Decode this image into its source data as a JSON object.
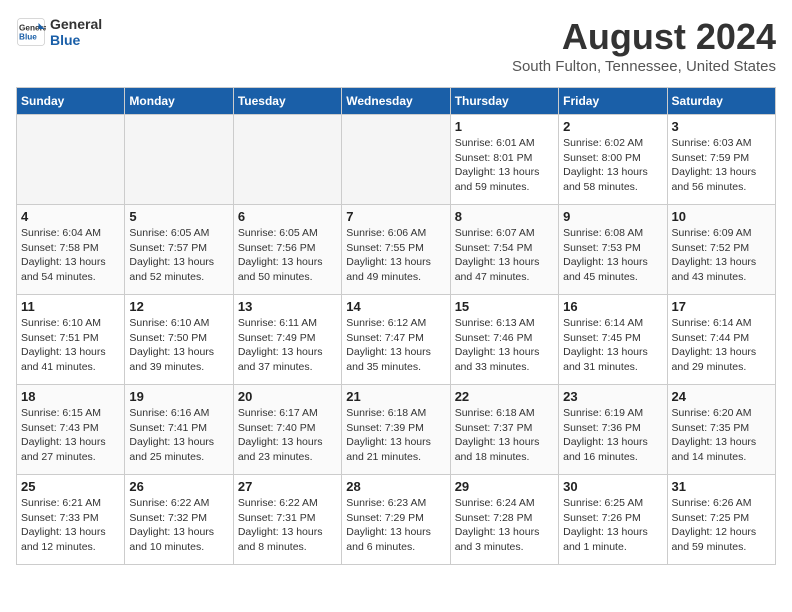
{
  "logo": {
    "line1": "General",
    "line2": "Blue"
  },
  "title": "August 2024",
  "location": "South Fulton, Tennessee, United States",
  "days_of_week": [
    "Sunday",
    "Monday",
    "Tuesday",
    "Wednesday",
    "Thursday",
    "Friday",
    "Saturday"
  ],
  "weeks": [
    [
      {
        "day": "",
        "info": ""
      },
      {
        "day": "",
        "info": ""
      },
      {
        "day": "",
        "info": ""
      },
      {
        "day": "",
        "info": ""
      },
      {
        "day": "1",
        "info": "Sunrise: 6:01 AM\nSunset: 8:01 PM\nDaylight: 13 hours\nand 59 minutes."
      },
      {
        "day": "2",
        "info": "Sunrise: 6:02 AM\nSunset: 8:00 PM\nDaylight: 13 hours\nand 58 minutes."
      },
      {
        "day": "3",
        "info": "Sunrise: 6:03 AM\nSunset: 7:59 PM\nDaylight: 13 hours\nand 56 minutes."
      }
    ],
    [
      {
        "day": "4",
        "info": "Sunrise: 6:04 AM\nSunset: 7:58 PM\nDaylight: 13 hours\nand 54 minutes."
      },
      {
        "day": "5",
        "info": "Sunrise: 6:05 AM\nSunset: 7:57 PM\nDaylight: 13 hours\nand 52 minutes."
      },
      {
        "day": "6",
        "info": "Sunrise: 6:05 AM\nSunset: 7:56 PM\nDaylight: 13 hours\nand 50 minutes."
      },
      {
        "day": "7",
        "info": "Sunrise: 6:06 AM\nSunset: 7:55 PM\nDaylight: 13 hours\nand 49 minutes."
      },
      {
        "day": "8",
        "info": "Sunrise: 6:07 AM\nSunset: 7:54 PM\nDaylight: 13 hours\nand 47 minutes."
      },
      {
        "day": "9",
        "info": "Sunrise: 6:08 AM\nSunset: 7:53 PM\nDaylight: 13 hours\nand 45 minutes."
      },
      {
        "day": "10",
        "info": "Sunrise: 6:09 AM\nSunset: 7:52 PM\nDaylight: 13 hours\nand 43 minutes."
      }
    ],
    [
      {
        "day": "11",
        "info": "Sunrise: 6:10 AM\nSunset: 7:51 PM\nDaylight: 13 hours\nand 41 minutes."
      },
      {
        "day": "12",
        "info": "Sunrise: 6:10 AM\nSunset: 7:50 PM\nDaylight: 13 hours\nand 39 minutes."
      },
      {
        "day": "13",
        "info": "Sunrise: 6:11 AM\nSunset: 7:49 PM\nDaylight: 13 hours\nand 37 minutes."
      },
      {
        "day": "14",
        "info": "Sunrise: 6:12 AM\nSunset: 7:47 PM\nDaylight: 13 hours\nand 35 minutes."
      },
      {
        "day": "15",
        "info": "Sunrise: 6:13 AM\nSunset: 7:46 PM\nDaylight: 13 hours\nand 33 minutes."
      },
      {
        "day": "16",
        "info": "Sunrise: 6:14 AM\nSunset: 7:45 PM\nDaylight: 13 hours\nand 31 minutes."
      },
      {
        "day": "17",
        "info": "Sunrise: 6:14 AM\nSunset: 7:44 PM\nDaylight: 13 hours\nand 29 minutes."
      }
    ],
    [
      {
        "day": "18",
        "info": "Sunrise: 6:15 AM\nSunset: 7:43 PM\nDaylight: 13 hours\nand 27 minutes."
      },
      {
        "day": "19",
        "info": "Sunrise: 6:16 AM\nSunset: 7:41 PM\nDaylight: 13 hours\nand 25 minutes."
      },
      {
        "day": "20",
        "info": "Sunrise: 6:17 AM\nSunset: 7:40 PM\nDaylight: 13 hours\nand 23 minutes."
      },
      {
        "day": "21",
        "info": "Sunrise: 6:18 AM\nSunset: 7:39 PM\nDaylight: 13 hours\nand 21 minutes."
      },
      {
        "day": "22",
        "info": "Sunrise: 6:18 AM\nSunset: 7:37 PM\nDaylight: 13 hours\nand 18 minutes."
      },
      {
        "day": "23",
        "info": "Sunrise: 6:19 AM\nSunset: 7:36 PM\nDaylight: 13 hours\nand 16 minutes."
      },
      {
        "day": "24",
        "info": "Sunrise: 6:20 AM\nSunset: 7:35 PM\nDaylight: 13 hours\nand 14 minutes."
      }
    ],
    [
      {
        "day": "25",
        "info": "Sunrise: 6:21 AM\nSunset: 7:33 PM\nDaylight: 13 hours\nand 12 minutes."
      },
      {
        "day": "26",
        "info": "Sunrise: 6:22 AM\nSunset: 7:32 PM\nDaylight: 13 hours\nand 10 minutes."
      },
      {
        "day": "27",
        "info": "Sunrise: 6:22 AM\nSunset: 7:31 PM\nDaylight: 13 hours\nand 8 minutes."
      },
      {
        "day": "28",
        "info": "Sunrise: 6:23 AM\nSunset: 7:29 PM\nDaylight: 13 hours\nand 6 minutes."
      },
      {
        "day": "29",
        "info": "Sunrise: 6:24 AM\nSunset: 7:28 PM\nDaylight: 13 hours\nand 3 minutes."
      },
      {
        "day": "30",
        "info": "Sunrise: 6:25 AM\nSunset: 7:26 PM\nDaylight: 13 hours\nand 1 minute."
      },
      {
        "day": "31",
        "info": "Sunrise: 6:26 AM\nSunset: 7:25 PM\nDaylight: 12 hours\nand 59 minutes."
      }
    ]
  ]
}
